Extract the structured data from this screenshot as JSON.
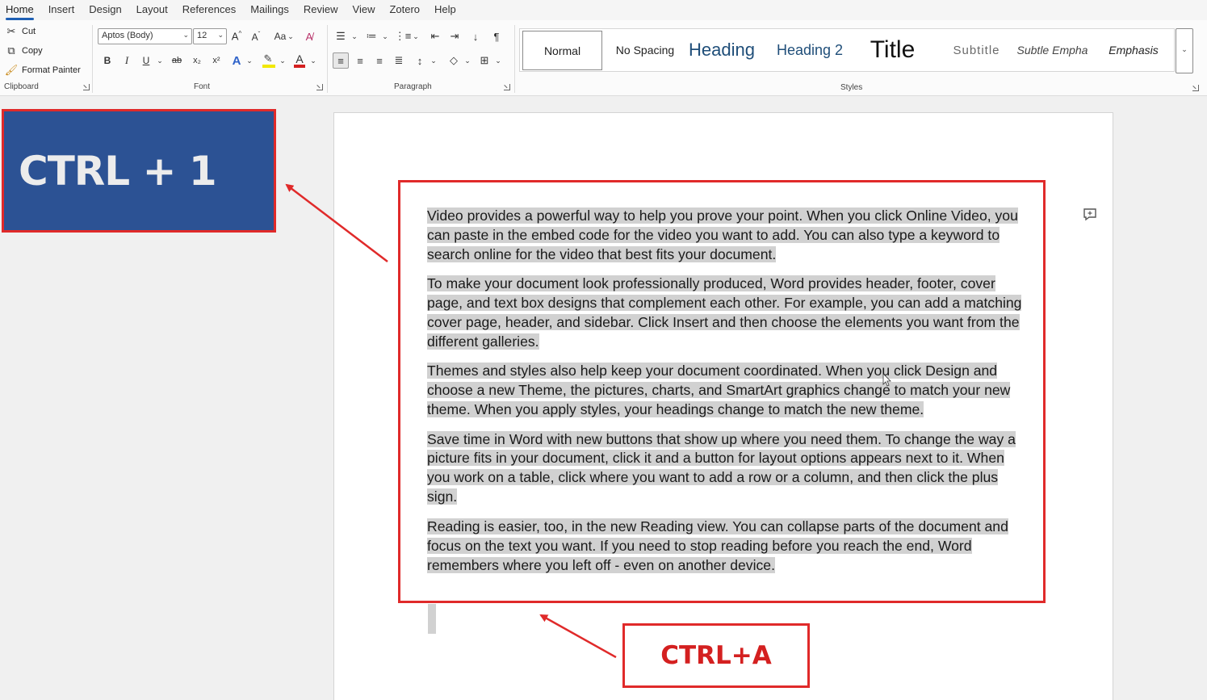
{
  "tabs": [
    "Home",
    "Insert",
    "Design",
    "Layout",
    "References",
    "Mailings",
    "Review",
    "View",
    "Zotero",
    "Help"
  ],
  "active_tab": "Home",
  "clipboard": {
    "cut": "Cut",
    "copy": "Copy",
    "format_painter": "Format Painter",
    "label": "Clipboard"
  },
  "font": {
    "name": "Aptos (Body)",
    "size": "12",
    "grow": "A^",
    "shrink": "A˅",
    "change_case": "Aa",
    "bold": "B",
    "italic": "I",
    "underline": "U",
    "strike": "ab",
    "subscript": "x₂",
    "superscript": "x²",
    "text_effects": "A",
    "font_color": "A",
    "label": "Font"
  },
  "paragraph": {
    "label": "Paragraph"
  },
  "styles": {
    "label": "Styles",
    "items": [
      "Normal",
      "No Spacing",
      "Heading 1",
      "Heading 2",
      "Title",
      "Subtitle",
      "Subtle Empha",
      "Emphasis"
    ],
    "heading1_display": "Heading"
  },
  "document": {
    "paragraphs": [
      "Video provides a powerful way to help you prove your point. When you click Online Video, you can paste in the embed code for the video you want to add. You can also type a keyword to search online for the video that best fits your document.",
      "To make your document look professionally produced, Word provides header, footer, cover page, and text box designs that complement each other. For example, you can add a matching cover page, header, and sidebar. Click Insert and then choose the elements you want from the different galleries.",
      "Themes and styles also help keep your document coordinated. When you click Design and choose a new Theme, the pictures, charts, and SmartArt graphics change to match your new theme. When you apply styles, your headings change to match the new theme.",
      "Save time in Word with new buttons that show up where you need them. To change the way a picture fits in your document, click it and a button for layout options appears next to it. When you work on a table, click where you want to add a row or a column, and then click the plus sign.",
      "Reading is easier, too, in the new Reading view. You can collapse parts of the document and focus on the text you want. If you need to stop reading before you reach the end, Word remembers where you left off - even on another device."
    ]
  },
  "annotations": {
    "ctrl1": "CTRL + 1",
    "ctrla": "CTRL+A"
  },
  "colors": {
    "accent_red": "#e02a2a",
    "callout_blue": "#2c5294",
    "selection_gray": "#d1d1d1",
    "heading_blue": "#1f4e79"
  },
  "icons": [
    "scissors-icon",
    "copy-icon",
    "format-painter-icon",
    "bullets-icon",
    "numbering-icon",
    "multilevel-list-icon",
    "decrease-indent-icon",
    "increase-indent-icon",
    "sort-icon",
    "pilcrow-icon",
    "align-left-icon",
    "center-icon",
    "align-right-icon",
    "justify-icon",
    "line-spacing-icon",
    "shading-icon",
    "borders-icon",
    "clear-formatting-icon",
    "highlight-icon",
    "comment-icon"
  ]
}
